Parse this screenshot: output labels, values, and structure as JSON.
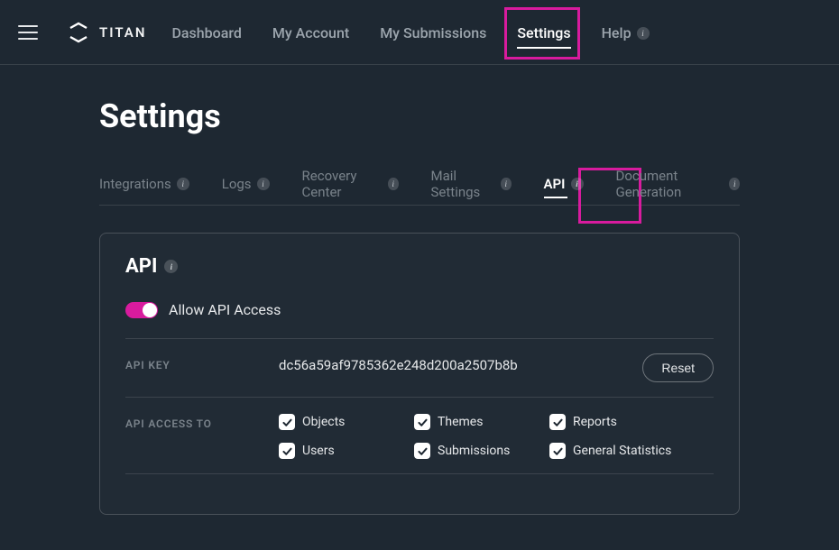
{
  "brand": {
    "name": "TITAN"
  },
  "nav": {
    "dashboard": "Dashboard",
    "my_account": "My Account",
    "my_submissions": "My Submissions",
    "settings": "Settings",
    "help": "Help"
  },
  "page": {
    "title": "Settings"
  },
  "tabs": {
    "integrations": "Integrations",
    "logs": "Logs",
    "recovery_center": "Recovery Center",
    "mail_settings": "Mail Settings",
    "api": "API",
    "document_generation": "Document Generation"
  },
  "card": {
    "title": "API",
    "toggle_label": "Allow API Access",
    "toggle_on": true,
    "api_key_label": "API KEY",
    "api_key_value": "dc56a59af9785362e248d200a2507b8b",
    "reset_button": "Reset",
    "access_to_label": "API ACCESS TO",
    "access": {
      "objects": {
        "label": "Objects",
        "checked": true
      },
      "themes": {
        "label": "Themes",
        "checked": true
      },
      "reports": {
        "label": "Reports",
        "checked": true
      },
      "users": {
        "label": "Users",
        "checked": true
      },
      "submissions": {
        "label": "Submissions",
        "checked": true
      },
      "general_statistics": {
        "label": "General Statistics",
        "checked": true
      }
    }
  },
  "colors": {
    "accent": "#d81b9e",
    "bg": "#1e2832",
    "card_bg": "#212b35"
  }
}
